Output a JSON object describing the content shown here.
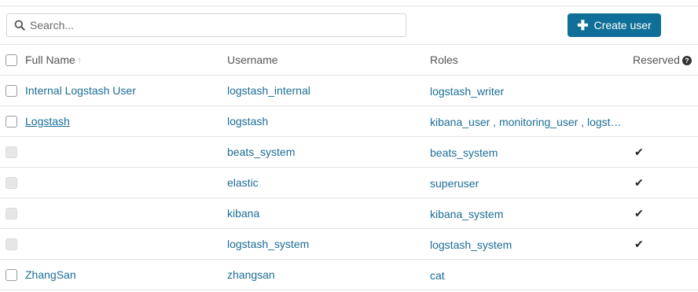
{
  "toolbar": {
    "search_placeholder": "Search...",
    "search_icon": "magnifier-icon",
    "create_label": "Create user",
    "create_icon": "plus-icon"
  },
  "table": {
    "columns": {
      "full_name": "Full Name",
      "username": "Username",
      "roles": "Roles",
      "reserved": "Reserved"
    },
    "sort_indicator": "↑",
    "help_glyph": "?",
    "reserved_mark": "✔",
    "rows": [
      {
        "full_name": "Internal Logstash User",
        "username": "logstash_internal",
        "roles": "logstash_writer",
        "reserved": false,
        "selectable": true
      },
      {
        "full_name": "Logstash",
        "username": "logstash",
        "roles": "kibana_user , monitoring_user , logstash_admin",
        "reserved": false,
        "selectable": true
      },
      {
        "full_name": "",
        "username": "beats_system",
        "roles": "beats_system",
        "reserved": true,
        "selectable": false
      },
      {
        "full_name": "",
        "username": "elastic",
        "roles": "superuser",
        "reserved": true,
        "selectable": false
      },
      {
        "full_name": "",
        "username": "kibana",
        "roles": "kibana_system",
        "reserved": true,
        "selectable": false
      },
      {
        "full_name": "",
        "username": "logstash_system",
        "roles": "logstash_system",
        "reserved": true,
        "selectable": false
      },
      {
        "full_name": "ZhangSan",
        "username": "zhangsan",
        "roles": "cat",
        "reserved": false,
        "selectable": true
      }
    ]
  },
  "colors": {
    "primary": "#0f6f98",
    "link": "#1b6d96",
    "border": "#e3e3e3"
  }
}
